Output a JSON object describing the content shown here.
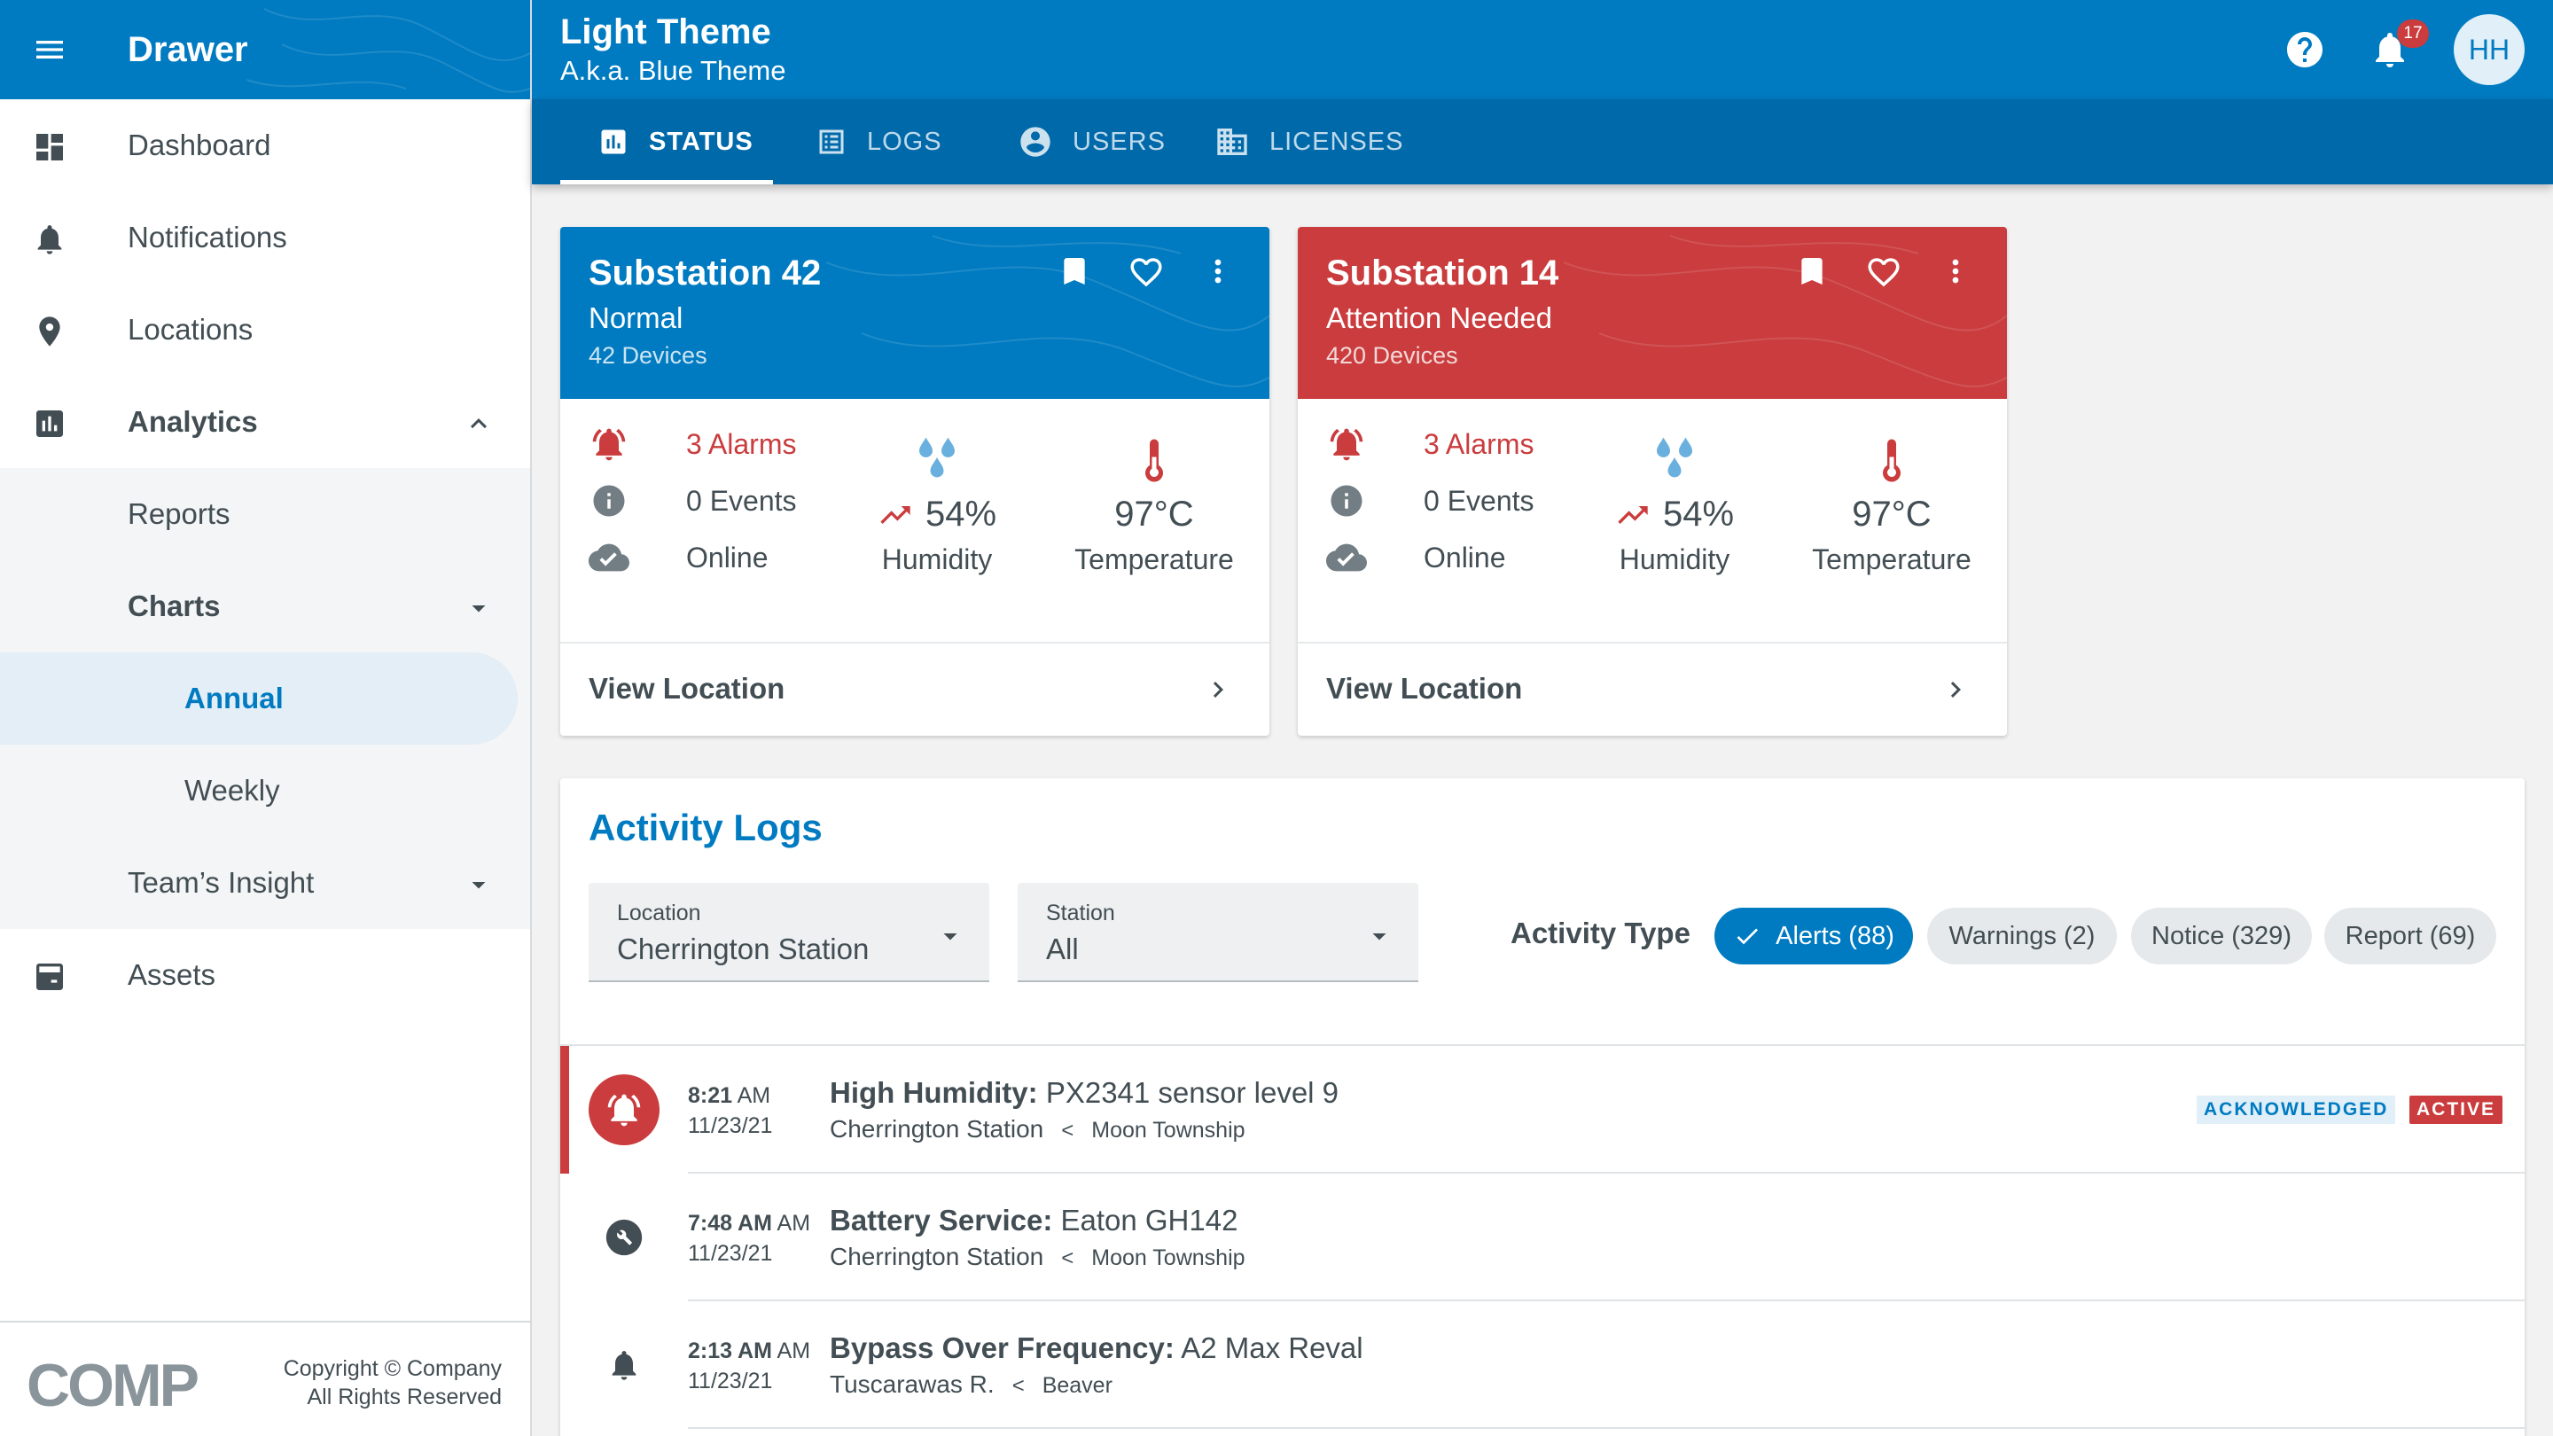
{
  "drawer": {
    "title": "Drawer",
    "items": [
      {
        "label": "Dashboard",
        "icon": "dashboard-icon"
      },
      {
        "label": "Notifications",
        "icon": "bell-icon"
      },
      {
        "label": "Locations",
        "icon": "location-pin-icon"
      },
      {
        "label": "Analytics",
        "icon": "analytics-icon"
      },
      {
        "label": "Reports"
      },
      {
        "label": "Charts"
      },
      {
        "label": "Annual"
      },
      {
        "label": "Weekly"
      },
      {
        "label": "Team’s Insight"
      },
      {
        "label": "Assets",
        "icon": "assets-icon"
      }
    ],
    "footer": {
      "logo": "COMP",
      "copyright_line1": "Copyright © Company",
      "copyright_line2": "All Rights Reserved"
    }
  },
  "appbar": {
    "title": "Light Theme",
    "subtitle": "A.k.a. Blue Theme",
    "notification_count": "17",
    "avatar_initials": "HH"
  },
  "tabs": [
    {
      "label": "STATUS",
      "icon": "chart-icon",
      "active": true
    },
    {
      "label": "LOGS",
      "icon": "list-icon",
      "active": false
    },
    {
      "label": "USERS",
      "icon": "account-circle-icon",
      "active": false
    },
    {
      "label": "LICENSES",
      "icon": "building-icon",
      "active": false
    }
  ],
  "cards": [
    {
      "title": "Substation 42",
      "status": "Normal",
      "devices": "42 Devices",
      "header_color": "#007bc1",
      "alarms": "3 Alarms",
      "events": "0 Events",
      "online": "Online",
      "humidity_value": "54",
      "humidity_unit": "%",
      "humidity_label": "Humidity",
      "temp_value": "97",
      "temp_unit": "°C",
      "temp_label": "Temperature",
      "footer": "View Location"
    },
    {
      "title": "Substation 14",
      "status": "Attention Needed",
      "devices": "420 Devices",
      "header_color": "#ca3c3d",
      "alarms": "3 Alarms",
      "events": "0 Events",
      "online": "Online",
      "humidity_value": "54",
      "humidity_unit": "%",
      "humidity_label": "Humidity",
      "temp_value": "97",
      "temp_unit": "°C",
      "temp_label": "Temperature",
      "footer": "View Location"
    }
  ],
  "activity": {
    "title": "Activity Logs",
    "location_label": "Location",
    "location_value": "Cherrington Station",
    "station_label": "Station",
    "station_value": "All",
    "type_label": "Activity Type",
    "chips": [
      "Alerts (88)",
      "Warnings (2)",
      "Notice (329)",
      "Report (69)"
    ],
    "entries": [
      {
        "time": "8:21",
        "ampm": "AM",
        "date": "11/23/21",
        "title": "High Humidity:",
        "detail": " PX2341 sensor level 9",
        "location": "Cherrington Station",
        "separator": "<",
        "sublocation": "Moon Township",
        "tags": [
          "ACKNOWLEDGED",
          "ACTIVE"
        ]
      },
      {
        "time": "7:48 AM",
        "ampm": "AM",
        "date": "11/23/21",
        "title": "Battery Service:",
        "detail": " Eaton GH142",
        "location": "Cherrington Station",
        "separator": "<",
        "sublocation": "Moon Township"
      },
      {
        "time": "2:13 AM",
        "ampm": "AM",
        "date": "11/23/21",
        "title": "Bypass Over Frequency:",
        "detail": " A2 Max Reval",
        "location": "Tuscarawas R.",
        "separator": "<",
        "sublocation": "Beaver"
      }
    ]
  },
  "colors": {
    "primary": "#007bc1",
    "primary_dark": "#0069aa",
    "alert_red": "#ca3c3d"
  }
}
